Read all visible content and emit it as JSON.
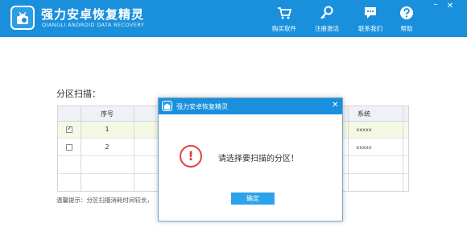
{
  "app": {
    "title": "强力安卓恢复精灵",
    "subtitle": "QIANGLI ANDROID DATA RECOVERY"
  },
  "window_controls": {
    "minimize": "–",
    "close": "✕"
  },
  "toolbar": {
    "buy_label": "购买软件",
    "register_label": "注册激活",
    "contact_label": "联系我们",
    "help_label": "帮助"
  },
  "section_label": "分区扫描：",
  "table": {
    "headers": {
      "num": "序号",
      "system": "系统"
    },
    "rows": [
      {
        "checked": true,
        "num": "1",
        "system": "xxxxx"
      },
      {
        "checked": false,
        "num": "2",
        "system": "xxxxx"
      }
    ]
  },
  "hint": "温馨提示：分区扫描消耗时间较长，",
  "dialog": {
    "title": "强力安卓恢复精灵",
    "close": "✕",
    "warning_glyph": "!",
    "message": "请选择要扫描的分区！",
    "ok_label": "确定"
  },
  "colors": {
    "brand_blue": "#1a90dd",
    "button_blue": "#2ba3ea",
    "warning_red": "#e14141",
    "selected_row": "#f4f9e6"
  }
}
